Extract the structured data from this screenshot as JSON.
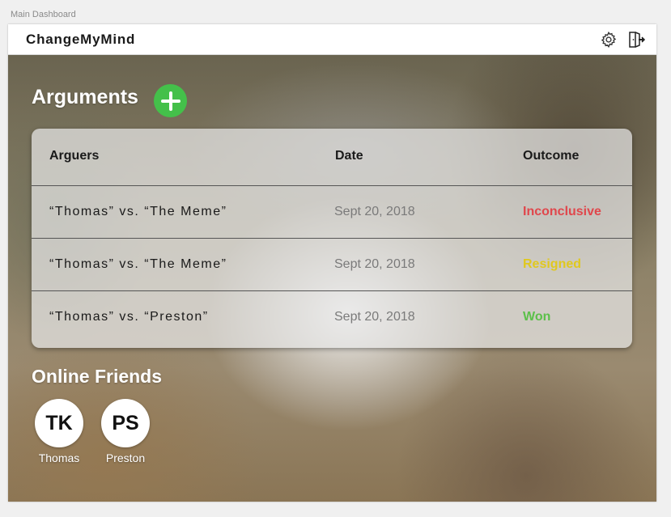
{
  "artboard_label": "Main Dashboard",
  "app": {
    "title": "ChangeMyMind",
    "icons": [
      "gear-icon",
      "logout-icon"
    ]
  },
  "arguments": {
    "title": "Arguments",
    "add_icon": "plus-icon",
    "add_color": "#44c04a",
    "columns": [
      "Arguers",
      "Date",
      "Outcome"
    ],
    "rows": [
      {
        "arguers": "“Thomas” vs. “The Meme”",
        "date": "Sept 20, 2018",
        "outcome": "Inconclusive",
        "outcome_color": "#e0474c"
      },
      {
        "arguers": "“Thomas” vs. “The Meme”",
        "date": "Sept 20, 2018",
        "outcome": "Resigned",
        "outcome_color": "#e0c81e"
      },
      {
        "arguers": "“Thomas” vs. “Preston”",
        "date": "Sept 20, 2018",
        "outcome": "Won",
        "outcome_color": "#5cc04a"
      }
    ]
  },
  "friends": {
    "title": "Online Friends",
    "list": [
      {
        "initials": "TK",
        "name": "Thomas"
      },
      {
        "initials": "PS",
        "name": "Preston"
      }
    ]
  }
}
